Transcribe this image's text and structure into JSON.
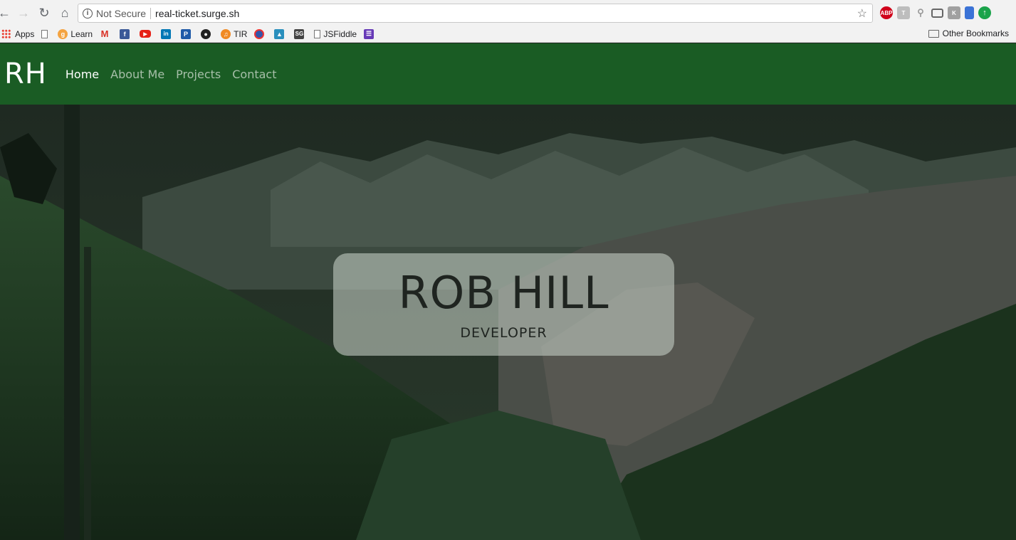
{
  "browser": {
    "security_label": "Not Secure",
    "url": "real-ticket.surge.sh",
    "extensions": [
      {
        "name": "adblock",
        "label": "ABP",
        "color": "#d0021b"
      },
      {
        "name": "type",
        "label": "T",
        "color": "#bdbdbd"
      },
      {
        "name": "search",
        "label": "",
        "color": "#c8c8c8"
      },
      {
        "name": "cast",
        "label": "",
        "color": "#9e9e9e"
      },
      {
        "name": "keyboard",
        "label": "K",
        "color": "#a0a0a0"
      },
      {
        "name": "bookmark",
        "label": "",
        "color": "#3b73d6"
      },
      {
        "name": "update",
        "label": "",
        "color": "#1aa34a"
      }
    ]
  },
  "bookmarks": {
    "items": [
      {
        "label": "Apps",
        "icon": "apps-icon"
      },
      {
        "label": "",
        "icon": "page-icon"
      },
      {
        "label": "Learn",
        "icon": "learn-icon"
      },
      {
        "label": "",
        "icon": "gmail-icon"
      },
      {
        "label": "",
        "icon": "facebook-icon"
      },
      {
        "label": "",
        "icon": "youtube-icon"
      },
      {
        "label": "",
        "icon": "linkedin-icon"
      },
      {
        "label": "",
        "icon": "producthunt-icon"
      },
      {
        "label": "",
        "icon": "github-icon"
      },
      {
        "label": "TIR",
        "icon": "tir-icon"
      },
      {
        "label": "",
        "icon": "target-icon"
      },
      {
        "label": "",
        "icon": "bird-icon"
      },
      {
        "label": "",
        "icon": "sg-icon"
      },
      {
        "label": "JSFiddle",
        "icon": "page-icon"
      },
      {
        "label": "",
        "icon": "list-icon"
      }
    ],
    "other": "Other Bookmarks"
  },
  "site": {
    "brand": "RH",
    "nav": [
      "Home",
      "About Me",
      "Projects",
      "Contact"
    ],
    "active_index": 0,
    "colors": {
      "nav_bg": "#1a5c24",
      "nav_link": "#a7bfa9",
      "nav_active": "#ffffff"
    }
  },
  "hero": {
    "name": "ROB HILL",
    "role": "DEVELOPER"
  }
}
